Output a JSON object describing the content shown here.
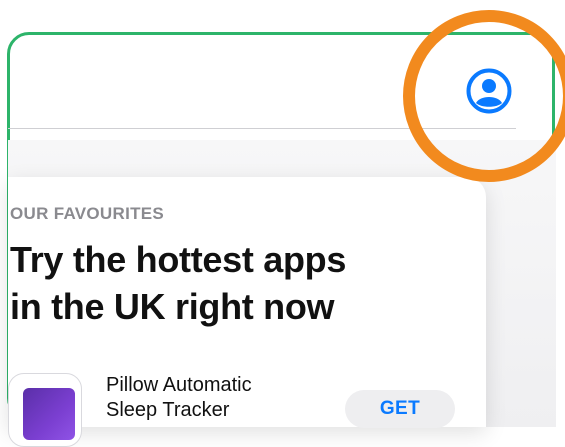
{
  "section": {
    "eyebrow": "OUR FAVOURITES"
  },
  "headline": {
    "line1": "Try the hottest apps",
    "line2": "in the UK right now"
  },
  "app": {
    "name_line1": "Pillow Automatic",
    "name_line2": "Sleep Tracker",
    "get_label": "GET"
  },
  "header": {
    "account_icon": "person-circle-icon"
  },
  "colors": {
    "accent": "#0A7AFF",
    "frame": "#2DB46A",
    "highlight": "#F28A1E"
  }
}
